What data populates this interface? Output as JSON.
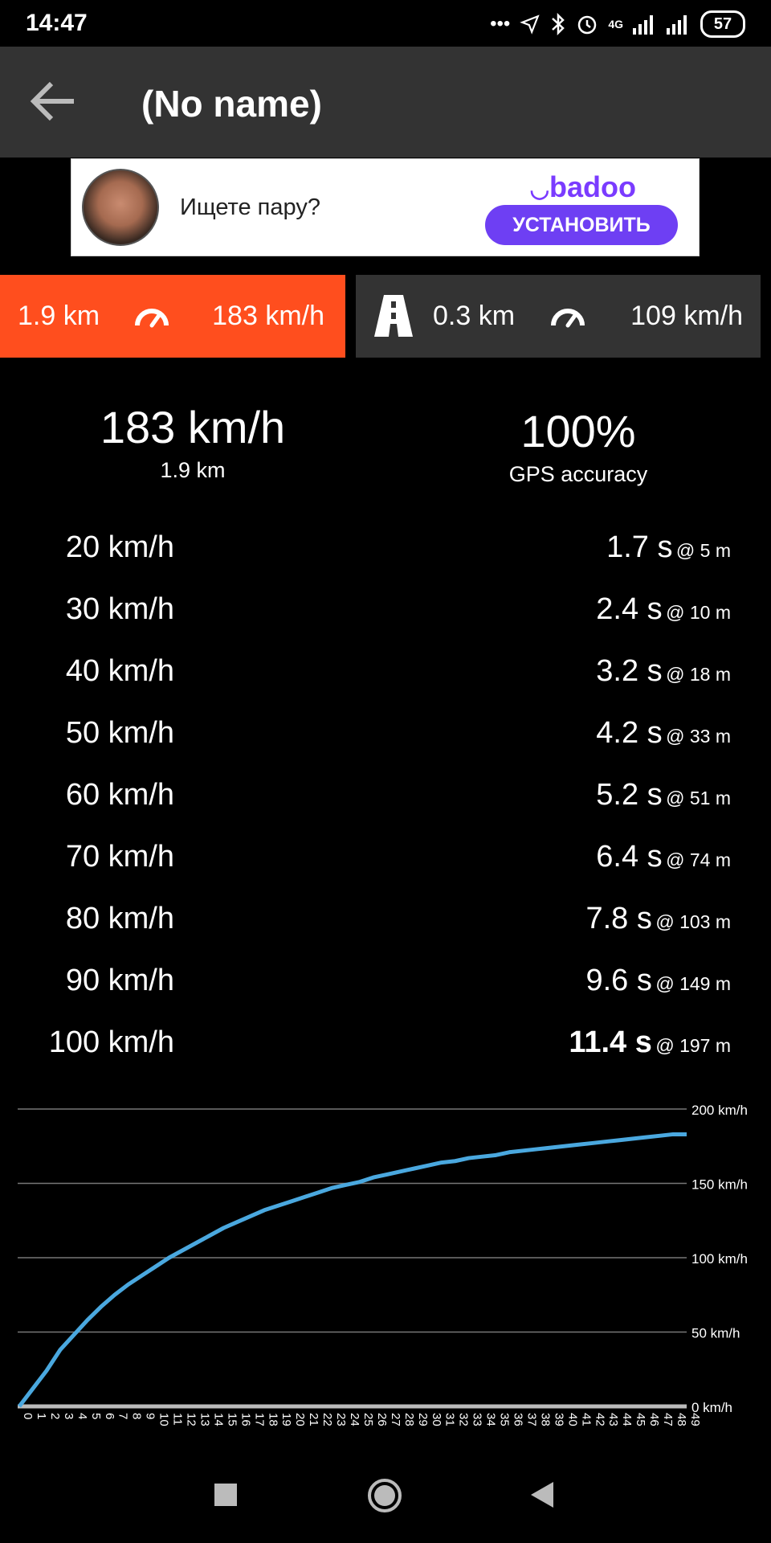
{
  "status_bar": {
    "time": "14:47",
    "network": "4G",
    "battery": "57"
  },
  "toolbar": {
    "title": "(No name)"
  },
  "ad": {
    "text": "Ищете пару?",
    "logo": "badoo",
    "install": "УСТАНОВИТЬ"
  },
  "tabs": {
    "current": {
      "distance": "1.9 km",
      "speed": "183 km/h"
    },
    "segment": {
      "distance": "0.3 km",
      "speed": "109 km/h"
    }
  },
  "summary": {
    "top_speed": "183 km/h",
    "distance": "1.9 km",
    "accuracy": "100%",
    "accuracy_label": "GPS accuracy"
  },
  "splits": [
    {
      "speed": "20 km/h",
      "time": "1.7 s",
      "at": "@ 5 m"
    },
    {
      "speed": "30 km/h",
      "time": "2.4 s",
      "at": "@ 10 m"
    },
    {
      "speed": "40 km/h",
      "time": "3.2 s",
      "at": "@ 18 m"
    },
    {
      "speed": "50 km/h",
      "time": "4.2 s",
      "at": "@ 33 m"
    },
    {
      "speed": "60 km/h",
      "time": "5.2 s",
      "at": "@ 51 m"
    },
    {
      "speed": "70 km/h",
      "time": "6.4 s",
      "at": "@ 74 m"
    },
    {
      "speed": "80 km/h",
      "time": "7.8 s",
      "at": "@ 103 m"
    },
    {
      "speed": "90 km/h",
      "time": "9.6 s",
      "at": "@ 149 m"
    },
    {
      "speed": "100 km/h",
      "time": "11.4 s",
      "at": "@ 197 m"
    }
  ],
  "colors": {
    "accent": "#ff4e1e",
    "line": "#4aa8df",
    "badoo": "#6e3ff3"
  },
  "chart_data": {
    "type": "line",
    "x": [
      0,
      1,
      2,
      3,
      4,
      5,
      6,
      7,
      8,
      9,
      10,
      11,
      12,
      13,
      14,
      15,
      16,
      17,
      18,
      19,
      20,
      21,
      22,
      23,
      24,
      25,
      26,
      27,
      28,
      29,
      30,
      31,
      32,
      33,
      34,
      35,
      36,
      37,
      38,
      39,
      40,
      41,
      42,
      43,
      44,
      45,
      46,
      47,
      48,
      49
    ],
    "y": [
      0,
      12,
      24,
      38,
      48,
      58,
      67,
      75,
      82,
      88,
      94,
      100,
      105,
      110,
      115,
      120,
      124,
      128,
      132,
      135,
      138,
      141,
      144,
      147,
      149,
      151,
      154,
      156,
      158,
      160,
      162,
      164,
      165,
      167,
      168,
      169,
      171,
      172,
      173,
      174,
      175,
      176,
      177,
      178,
      179,
      180,
      181,
      182,
      183,
      183
    ],
    "yticks": [
      "0 km/h",
      "50 km/h",
      "100 km/h",
      "150 km/h",
      "200 km/h"
    ],
    "ytick_values": [
      0,
      50,
      100,
      150,
      200
    ],
    "ylim": [
      0,
      200
    ],
    "xlim": [
      0,
      49
    ],
    "grid": true,
    "xlabel": "",
    "ylabel": ""
  }
}
